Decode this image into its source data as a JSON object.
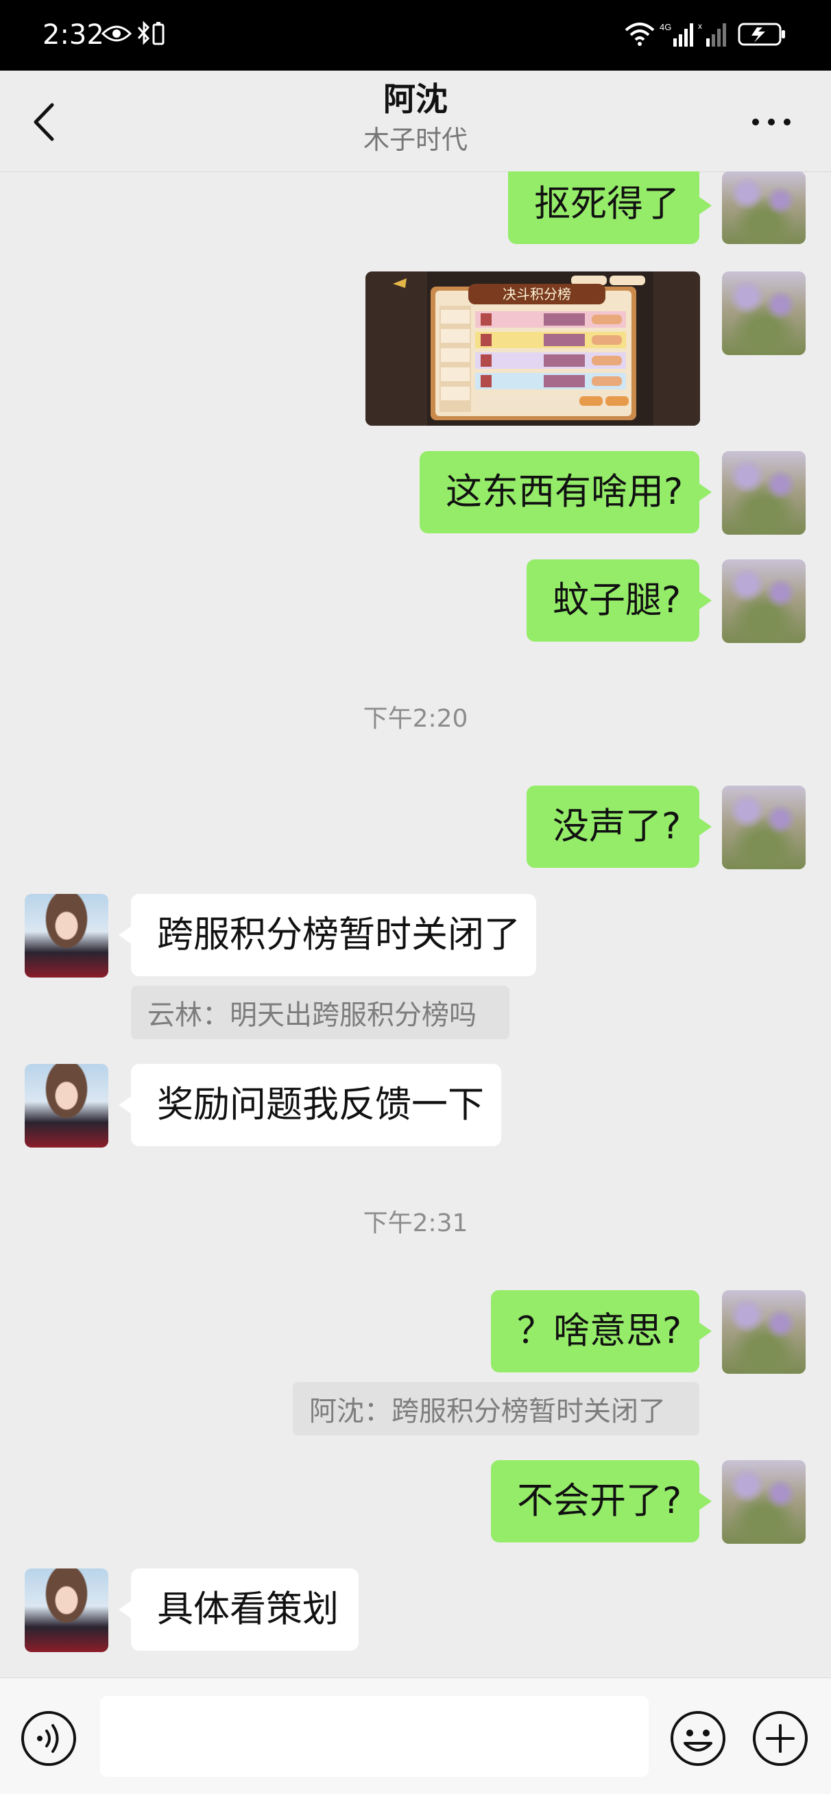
{
  "status_bar": {
    "time": "2:32",
    "network_label": "4G"
  },
  "header": {
    "title": "阿沈",
    "subtitle": "木子时代"
  },
  "messages": [
    {
      "side": "right",
      "text": "抠死得了"
    },
    {
      "side": "right",
      "type": "image",
      "image_title": "决斗积分榜"
    },
    {
      "side": "right",
      "text": "这东西有啥用?"
    },
    {
      "side": "right",
      "text": "蚊子腿?"
    },
    {
      "type": "time",
      "text": "下午2:20"
    },
    {
      "side": "right",
      "text": "没声了?"
    },
    {
      "side": "left",
      "text": "跨服积分榜暂时关闭了"
    },
    {
      "side": "left",
      "type": "quote",
      "text": "云林：明天出跨服积分榜吗"
    },
    {
      "side": "left",
      "text": "奖励问题我反馈一下"
    },
    {
      "type": "time",
      "text": "下午2:31"
    },
    {
      "side": "right",
      "text": "？啥意思?"
    },
    {
      "side": "right",
      "type": "quote",
      "text": "阿沈：跨服积分榜暂时关闭了"
    },
    {
      "side": "right",
      "text": "不会开了?"
    },
    {
      "side": "left",
      "text": "具体看策划"
    }
  ],
  "input": {
    "placeholder": ""
  },
  "icons": {
    "back": "chevron-left-icon",
    "more": "more-icon",
    "voice": "voice-icon",
    "emoji": "emoji-icon",
    "plus": "plus-icon"
  },
  "colors": {
    "chat_background": "#ededed",
    "my_bubble": "#95ec69",
    "their_bubble": "#ffffff",
    "status_bar": "#000000"
  }
}
